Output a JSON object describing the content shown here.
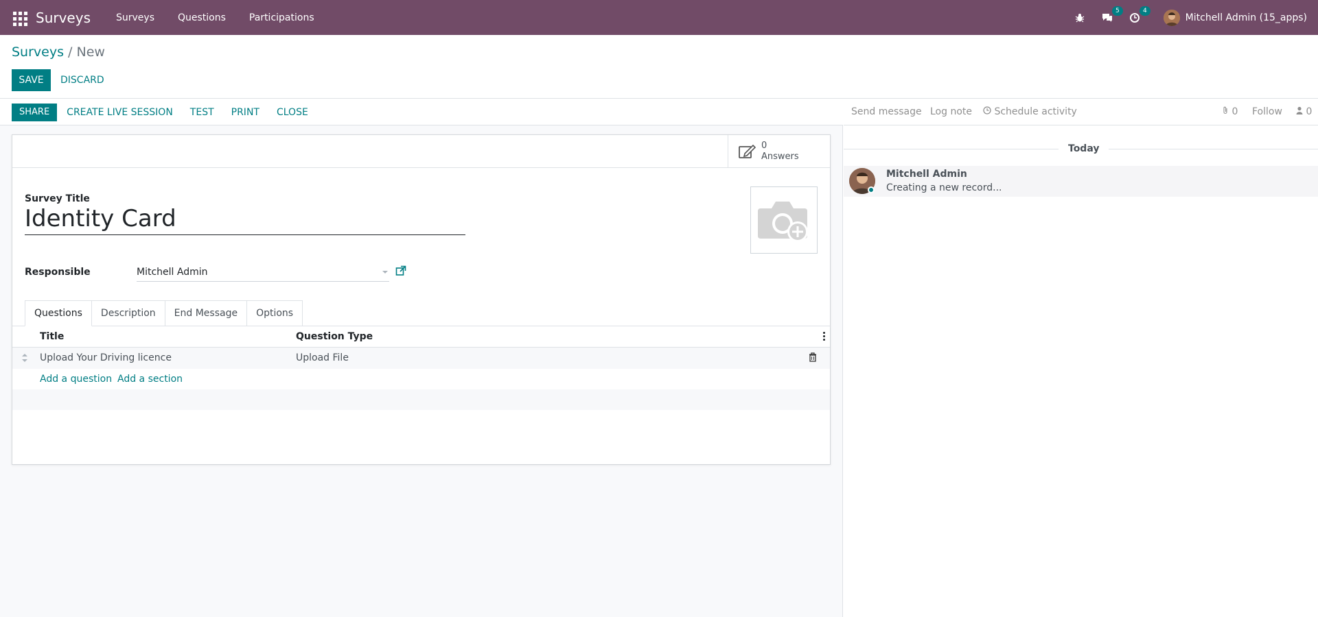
{
  "navbar": {
    "app_name": "Surveys",
    "menu": [
      "Surveys",
      "Questions",
      "Participations"
    ],
    "messages_badge": "5",
    "activities_badge": "4",
    "user": "Mitchell Admin (15_apps)"
  },
  "breadcrumb": {
    "parent": "Surveys",
    "separator": "/",
    "current": "New"
  },
  "actions": {
    "save": "SAVE",
    "discard": "DISCARD"
  },
  "statusbar": {
    "share": "SHARE",
    "live_session": "CREATE LIVE SESSION",
    "test": "TEST",
    "print": "PRINT",
    "close": "CLOSE"
  },
  "stat_button": {
    "value": "0",
    "label": "Answers"
  },
  "form": {
    "title_label": "Survey Title",
    "title_value": "Identity Card",
    "responsible_label": "Responsible",
    "responsible_value": "Mitchell Admin"
  },
  "tabs": [
    "Questions",
    "Description",
    "End Message",
    "Options"
  ],
  "list": {
    "columns": [
      "Title",
      "Question Type"
    ],
    "rows": [
      {
        "title": "Upload Your Driving licence",
        "type": "Upload File"
      }
    ],
    "add_question": "Add a question",
    "add_section": "Add a section"
  },
  "chatter": {
    "send_message": "Send message",
    "log_note": "Log note",
    "schedule_activity": "Schedule activity",
    "attachments_count": "0",
    "follow": "Follow",
    "followers_count": "0",
    "date_separator": "Today",
    "message": {
      "author": "Mitchell Admin",
      "body": "Creating a new record..."
    }
  },
  "colors": {
    "navbar": "#714B67",
    "accent": "#017e84"
  }
}
